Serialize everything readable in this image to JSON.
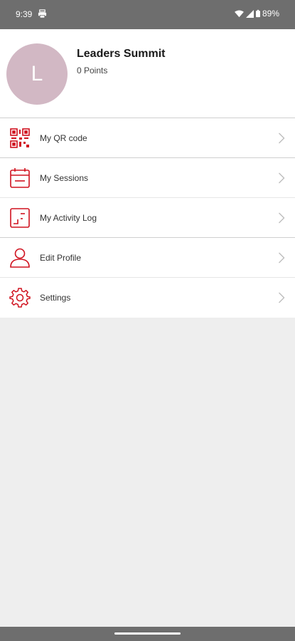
{
  "status_bar": {
    "time": "9:39",
    "notification_icon": "printer-icon",
    "wifi_icon": "wifi-icon",
    "signal_icon": "cell-signal-icon",
    "battery_icon": "battery-icon",
    "battery_percent": "89%"
  },
  "profile": {
    "avatar_letter": "L",
    "avatar_color": "#d2b8c4",
    "name": "Leaders Summit",
    "points": "0 Points"
  },
  "menu": {
    "accent_color": "#d0121f",
    "items": [
      {
        "label": "My QR code",
        "icon": "qr-code-icon"
      },
      {
        "label": "My Sessions",
        "icon": "calendar-icon"
      },
      {
        "label": "My Activity Log",
        "icon": "activity-log-icon"
      },
      {
        "label": "Edit Profile",
        "icon": "person-icon"
      },
      {
        "label": "Settings",
        "icon": "gear-icon"
      }
    ]
  }
}
